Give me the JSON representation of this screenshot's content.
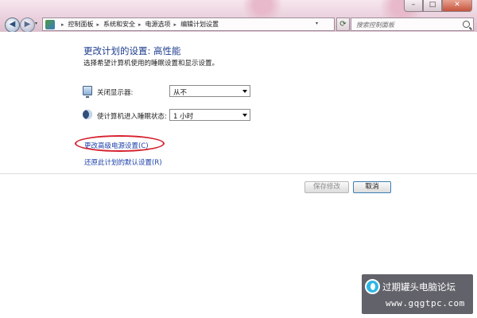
{
  "window": {
    "minimize_label": "–",
    "maximize_label": "□",
    "close_label": "✕"
  },
  "navigation": {
    "back_glyph": "◀",
    "forward_glyph": "▶",
    "dropdown_glyph": "▾",
    "refresh_glyph": "⟳"
  },
  "address_bar": {
    "breadcrumbs": [
      {
        "label": "控制面板"
      },
      {
        "label": "系统和安全"
      },
      {
        "label": "电源选项"
      },
      {
        "label": "编辑计划设置"
      }
    ],
    "separator": "▸"
  },
  "search": {
    "placeholder": "搜索控制面板"
  },
  "page": {
    "title": "更改计划的设置: 高性能",
    "description": "选择希望计算机使用的睡眠设置和显示设置。",
    "settings": [
      {
        "label": "关闭显示器:",
        "selected": "从不",
        "icon": "monitor-icon"
      },
      {
        "label": "使计算机进入睡眠状态:",
        "selected": "1 小时",
        "icon": "moon-icon"
      }
    ],
    "links": {
      "advanced": "更改高级电源设置(C)",
      "restore": "还原此计划的默认设置(R)"
    },
    "buttons": {
      "save": "保存修改",
      "cancel": "取消"
    }
  },
  "watermark": {
    "title": "过期罐头电脑论坛",
    "url": "www.gqgtpc.com"
  },
  "colors": {
    "link": "#1a3fa8",
    "title": "#1e3d8f",
    "highlight": "#d5212e"
  }
}
